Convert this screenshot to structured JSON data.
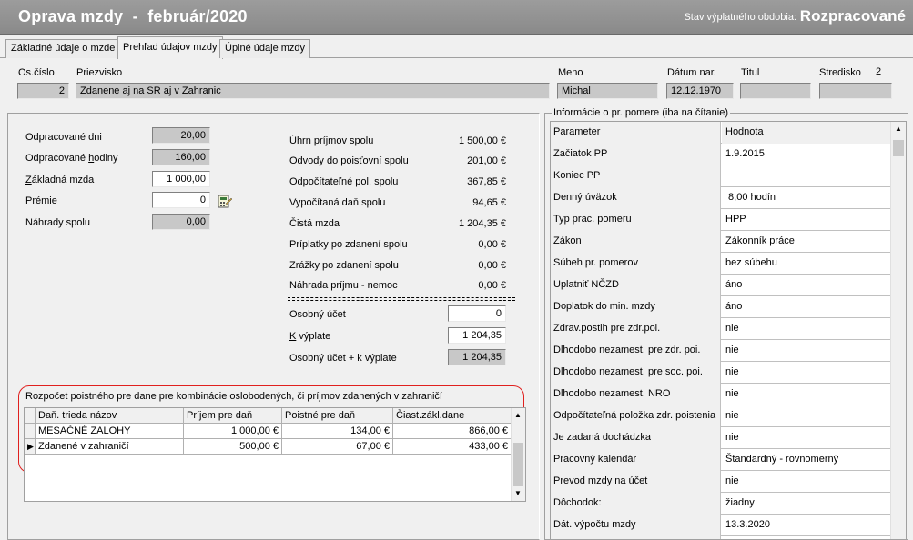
{
  "window": {
    "title": "Oprava mzdy  -  február/2020",
    "status_label": "Stav výplatného obdobia:",
    "status_value": "Rozpracované"
  },
  "tabs": [
    {
      "label": "Základné údaje o mzde"
    },
    {
      "label": "Prehľad údajov mzdy"
    },
    {
      "label": "Úplné údaje mzdy"
    }
  ],
  "header": {
    "os_cislo_label": "Os.číslo",
    "os_cislo_value": "2",
    "priezvisko_label": "Priezvisko",
    "priezvisko_value": "Zdanene aj na SR aj v Zahranic",
    "meno_label": "Meno",
    "meno_value": "Michal",
    "datum_nar_label": "Dátum nar.",
    "datum_nar_value": "12.12.1970",
    "titul_label": "Titul",
    "titul_value": "",
    "stredisko_label": "Stredisko",
    "stredisko_value": "2"
  },
  "left_fields": {
    "odpracovane_dni_label": "Odpracované dni",
    "odpracovane_dni_value": "20,00",
    "odpracovane_hodiny_label_a": "Odpracované ",
    "odpracovane_hodiny_label_u": "h",
    "odpracovane_hodiny_label_b": "odiny",
    "odpracovane_hodiny_value": "160,00",
    "zakladna_mzda_label_u": "Z",
    "zakladna_mzda_label_b": "ákladná mzda",
    "zakladna_mzda_value": "1 000,00",
    "premie_label_u": "P",
    "premie_label_b": "rémie",
    "premie_value": "0",
    "nahrady_label": "Náhrady spolu",
    "nahrady_value": "0,00"
  },
  "summary": [
    {
      "label": "Úhrn príjmov spolu",
      "value": "1 500,00 €"
    },
    {
      "label": "Odvody do poisťovní spolu",
      "value": "201,00 €"
    },
    {
      "label": "Odpočítateľné pol. spolu",
      "value": "367,85 €"
    },
    {
      "label": "Vypočítaná daň spolu",
      "value": "94,65 €"
    },
    {
      "label": "Čistá mzda",
      "value": "1 204,35 €"
    },
    {
      "label": "Príplatky po zdanení spolu",
      "value": "0,00 €"
    },
    {
      "label": "Zrážky po zdanení spolu",
      "value": "0,00 €"
    },
    {
      "label": "Náhrada príjmu - nemoc",
      "value": "0,00 €"
    }
  ],
  "osobny_ucet": {
    "label": "Osobný účet",
    "value": "0",
    "k_vyplate_label_u": "K",
    "k_vyplate_label_b": " výplate",
    "k_vyplate_value": "1 204,35",
    "sum_label": "Osobný účet + k výplate",
    "sum_value": "1 204,35"
  },
  "zahranicie": {
    "title": "Rozpočet poistného pre dane pre kombinácie oslobodených, či príjmov zdanených v zahraničí",
    "columns": [
      "Daň. trieda názov",
      "Príjem pre daň",
      "Poistné pre daň",
      "Čiast.zákl.dane"
    ],
    "rows": [
      {
        "marker": "",
        "name": "MESAČNÉ ZALOHY",
        "prijem": "1 000,00 €",
        "poistne": "134,00 €",
        "ciast": "866,00 €"
      },
      {
        "marker": "▶",
        "name": "Zdanené v zahraničí",
        "prijem": "500,00 €",
        "poistne": "67,00 €",
        "ciast": "433,00 €"
      }
    ]
  },
  "info_panel": {
    "title": "Informácie o pr. pomere (iba na čítanie)",
    "col_param": "Parameter",
    "col_value": "Hodnota",
    "rows": [
      {
        "k": "Začiatok PP",
        "v": "1.9.2015"
      },
      {
        "k": "Koniec PP",
        "v": ""
      },
      {
        "k": "Denný úväzok",
        "v": " 8,00 hodín"
      },
      {
        "k": "Typ prac. pomeru",
        "v": "HPP"
      },
      {
        "k": "Zákon",
        "v": "Zákonník práce"
      },
      {
        "k": "Súbeh pr. pomerov",
        "v": "bez súbehu"
      },
      {
        "k": "Uplatniť NČZD",
        "v": "áno"
      },
      {
        "k": "Doplatok do min. mzdy",
        "v": "áno"
      },
      {
        "k": "Zdrav.postih pre zdr.poi.",
        "v": "nie"
      },
      {
        "k": "Dlhodobo nezamest. pre zdr. poi.",
        "v": "nie"
      },
      {
        "k": "Dlhodobo nezamest. pre soc. poi.",
        "v": "nie"
      },
      {
        "k": "Dlhodobo nezamest. NRO",
        "v": "nie"
      },
      {
        "k": "Odpočítateľná položka zdr. poistenia",
        "v": "nie"
      },
      {
        "k": "Je zadaná dochádzka",
        "v": "nie"
      },
      {
        "k": "Pracovný kalendár",
        "v": "Štandardný - rovnomerný"
      },
      {
        "k": "Prevod mzdy na účet",
        "v": "nie"
      },
      {
        "k": "Dôchodok:",
        "v": "žiadny"
      },
      {
        "k": "Dát. výpočtu mzdy",
        "v": "13.3.2020"
      },
      {
        "k": "",
        "v": ""
      }
    ]
  },
  "icons": {
    "calculator": "calculator-icon",
    "row_pointer": "row-pointer-icon"
  }
}
